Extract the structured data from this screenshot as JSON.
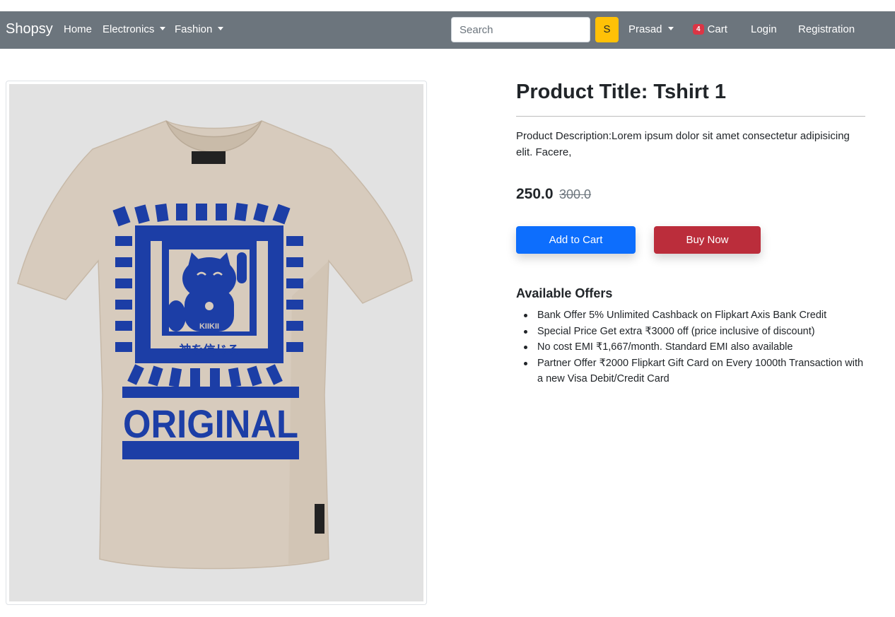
{
  "navbar": {
    "brand": "Shopsy",
    "links": {
      "home": "Home",
      "electronics": "Electronics",
      "fashion": "Fashion",
      "user": "Prasad",
      "cart": "Cart",
      "login": "Login",
      "registration": "Registration"
    },
    "cart_count": "4",
    "search": {
      "placeholder": "Search",
      "button_label": "S"
    }
  },
  "product": {
    "title": "Product Title: Tshirt 1",
    "description": "Product Description:Lorem ipsum dolor sit amet consectetur adipisicing elit. Facere,",
    "price": "250.0",
    "original_price": "300.0",
    "buttons": {
      "add_to_cart": "Add to Cart",
      "buy_now": "Buy Now"
    },
    "image": {
      "brand_label": "KIIKII",
      "jp_text": "神を信じる",
      "print_text": "ORIGINAL"
    }
  },
  "offers": {
    "title": "Available Offers",
    "items": [
      "Bank Offer 5% Unlimited Cashback on Flipkart Axis Bank Credit",
      "Special Price Get extra ₹3000 off (price inclusive of discount)",
      "No cost EMI ₹1,667/month. Standard EMI also available",
      "Partner Offer ₹2000 Flipkart Gift Card on Every 1000th Transaction with a new Visa Debit/Credit Card"
    ]
  },
  "colors": {
    "navbar_bg": "#6c757d",
    "search_button": "#ffc107",
    "add_to_cart": "#0d6efd",
    "buy_now": "#bb2d3b",
    "cart_badge": "#dc3545",
    "shirt_color": "#d7cbbd",
    "print_color": "#1c3ea6"
  }
}
